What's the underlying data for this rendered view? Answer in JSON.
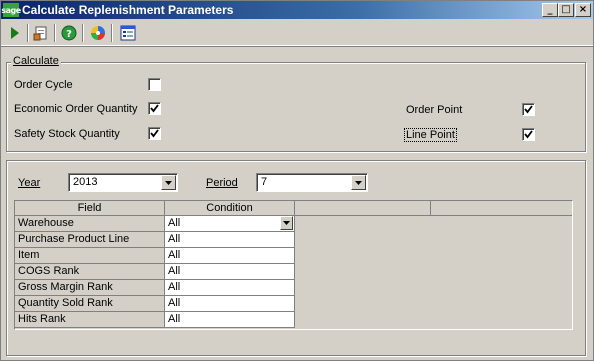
{
  "window": {
    "logo_text": "sage",
    "title": "Calculate Replenishment Parameters",
    "buttons": [
      "_",
      "□",
      "×"
    ]
  },
  "toolbar": {
    "tools": [
      "run-icon",
      "print-preview-icon",
      "help-icon",
      "color-wheel-icon",
      "settings-form-icon"
    ]
  },
  "calculate": {
    "legend": "Calculate",
    "order_cycle": {
      "label": "Order Cycle",
      "checked": false
    },
    "eoq": {
      "label": "Economic Order Quantity",
      "checked": true
    },
    "safety_stock": {
      "label": "Safety Stock Quantity",
      "checked": true
    },
    "order_point": {
      "label": "Order Point",
      "checked": true
    },
    "line_point": {
      "label": "Line Point",
      "checked": true
    }
  },
  "filters": {
    "year_label": "Year",
    "year_value": "2013",
    "period_label": "Period",
    "period_value": "7"
  },
  "grid": {
    "headers": [
      "Field",
      "Condition"
    ],
    "rows": [
      {
        "field": "Warehouse",
        "condition": "All"
      },
      {
        "field": "Purchase Product Line",
        "condition": "All"
      },
      {
        "field": "Item",
        "condition": "All"
      },
      {
        "field": "COGS Rank",
        "condition": "All"
      },
      {
        "field": "Gross Margin Rank",
        "condition": "All"
      },
      {
        "field": "Quantity Sold Rank",
        "condition": "All"
      },
      {
        "field": "Hits Rank",
        "condition": "All"
      }
    ]
  }
}
